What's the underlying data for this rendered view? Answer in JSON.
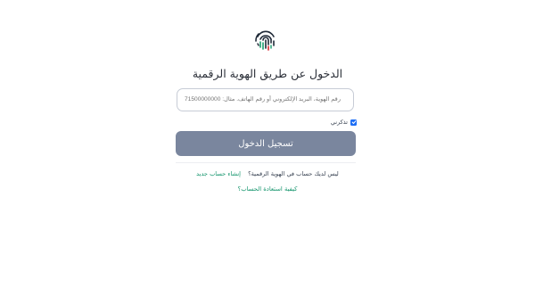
{
  "login": {
    "title": "الدخول عن طريق الهوية الرقمية",
    "identifier_placeholder": "رقم الهوية، البريد الإلكتروني أو رقم الهاتف. مثال: 971500000000",
    "remember_label": "تذكرني",
    "remember_checked": true,
    "submit_label": "تسجيل الدخول",
    "no_account_text": "ليس لديك حساب في الهوية الرقمية؟",
    "create_account_label": "إنشاء حساب جديد",
    "recover_account_label": "كيفية استعادة الحساب؟"
  },
  "icons": {
    "logo": "fingerprint-icon",
    "check": "checkmark-icon"
  },
  "colors": {
    "button_bg": "#7a869e",
    "link": "#12946b",
    "checkbox": "#1d6ef5",
    "logo_green": "#1a9b6c",
    "logo_red": "#d8262f"
  }
}
